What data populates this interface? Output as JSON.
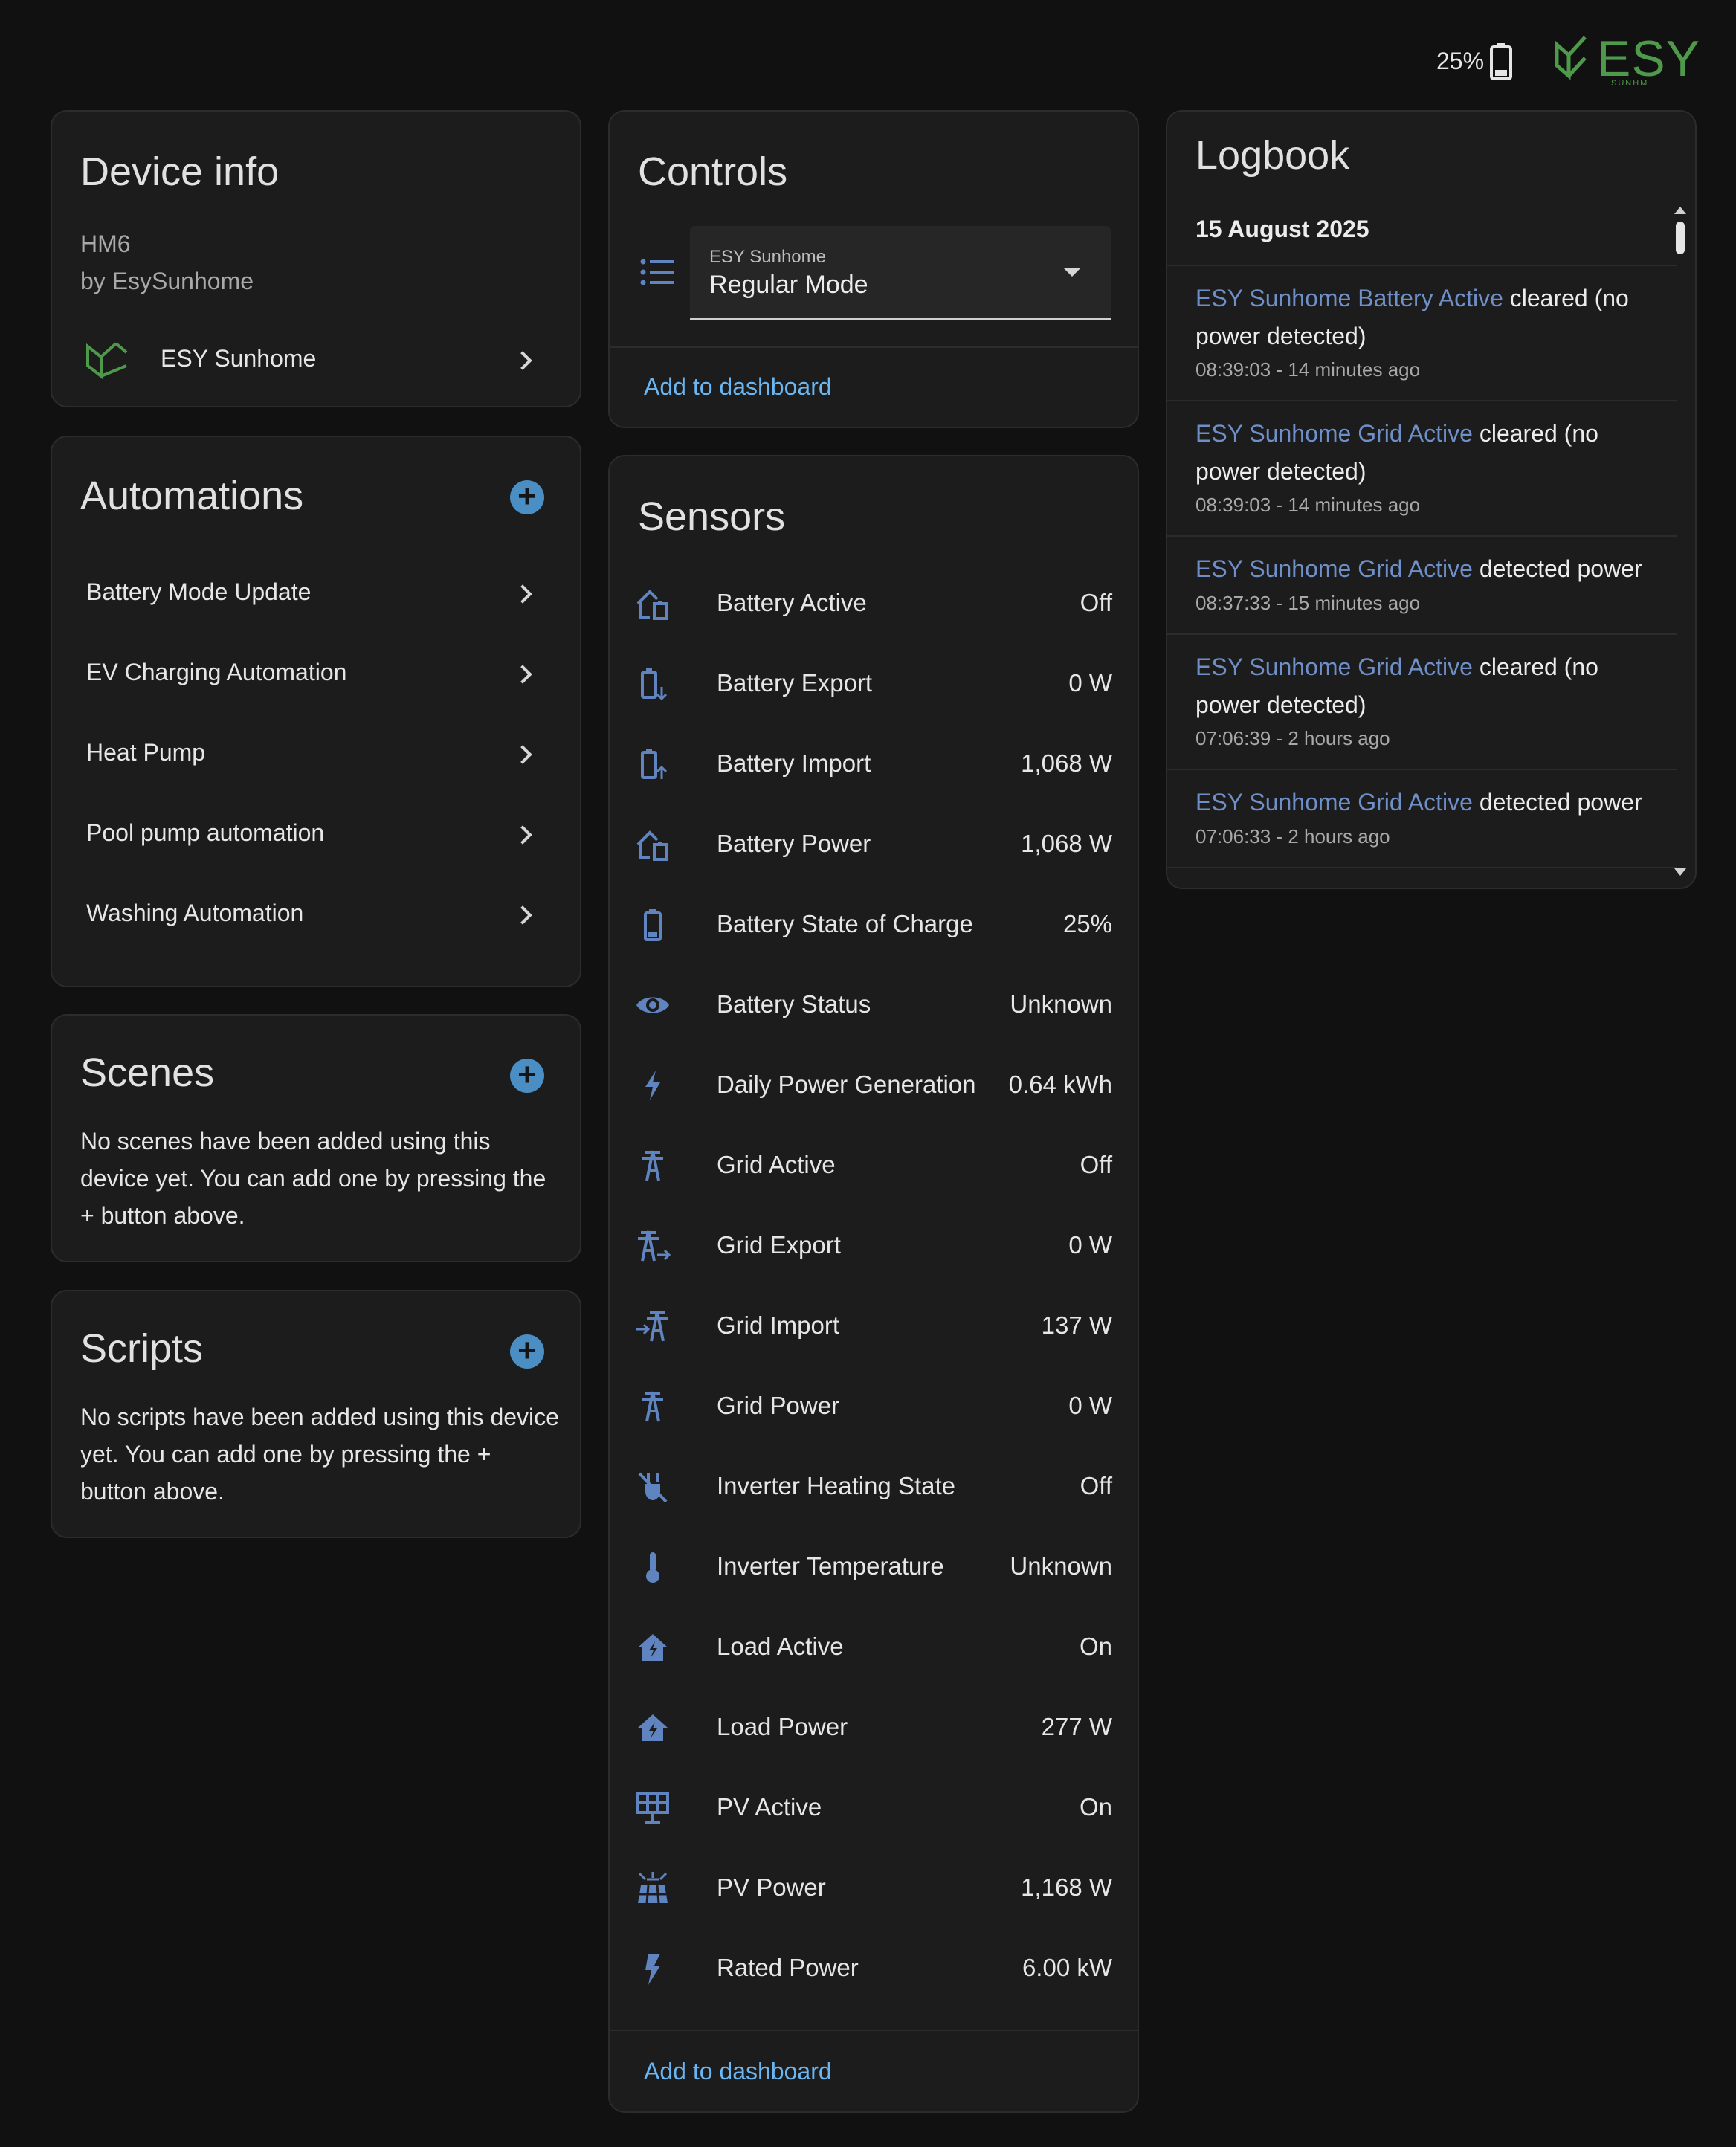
{
  "header": {
    "battery_percent": "25%",
    "brand_word": "ESY",
    "brand_sub": "SUNHM",
    "brand_color": "#4f9a4a"
  },
  "device_info": {
    "title": "Device info",
    "model": "HM6",
    "manufacturer": "by EsySunhome",
    "device_name": "ESY Sunhome"
  },
  "automations": {
    "title": "Automations",
    "items": [
      {
        "label": "Battery Mode Update"
      },
      {
        "label": "EV Charging Automation"
      },
      {
        "label": "Heat Pump"
      },
      {
        "label": "Pool pump automation"
      },
      {
        "label": "Washing Automation"
      }
    ]
  },
  "scenes": {
    "title": "Scenes",
    "empty_text": "No scenes have been added using this device yet. You can add one by pressing the + button above."
  },
  "scripts": {
    "title": "Scripts",
    "empty_text": "No scripts have been added using this device yet. You can add one by pressing the + button above."
  },
  "controls": {
    "title": "Controls",
    "select_label": "ESY Sunhome",
    "select_value": "Regular Mode",
    "add_to_dashboard": "Add to dashboard"
  },
  "sensors": {
    "title": "Sensors",
    "add_to_dashboard": "Add to dashboard",
    "icon_color": "#5f84bf",
    "items": [
      {
        "name": "Battery Active",
        "value": "Off",
        "icon": "home-battery-icon"
      },
      {
        "name": "Battery Export",
        "value": "0 W",
        "icon": "battery-arrow-down-icon"
      },
      {
        "name": "Battery Import",
        "value": "1,068 W",
        "icon": "battery-arrow-up-icon"
      },
      {
        "name": "Battery Power",
        "value": "1,068 W",
        "icon": "home-battery-icon"
      },
      {
        "name": "Battery State of Charge",
        "value": "25%",
        "icon": "battery-icon"
      },
      {
        "name": "Battery Status",
        "value": "Unknown",
        "icon": "eye-icon"
      },
      {
        "name": "Daily Power Generation",
        "value": "0.64 kWh",
        "icon": "flash-icon"
      },
      {
        "name": "Grid Active",
        "value": "Off",
        "icon": "transmission-tower-icon"
      },
      {
        "name": "Grid Export",
        "value": "0 W",
        "icon": "transmission-tower-export-icon"
      },
      {
        "name": "Grid Import",
        "value": "137 W",
        "icon": "transmission-tower-import-icon"
      },
      {
        "name": "Grid Power",
        "value": "0 W",
        "icon": "transmission-tower-icon"
      },
      {
        "name": "Inverter Heating State",
        "value": "Off",
        "icon": "heating-off-icon"
      },
      {
        "name": "Inverter Temperature",
        "value": "Unknown",
        "icon": "thermometer-icon"
      },
      {
        "name": "Load Active",
        "value": "On",
        "icon": "home-lightning-icon"
      },
      {
        "name": "Load Power",
        "value": "277 W",
        "icon": "home-lightning-icon"
      },
      {
        "name": "PV Active",
        "value": "On",
        "icon": "solar-panel-icon"
      },
      {
        "name": "PV Power",
        "value": "1,168 W",
        "icon": "solar-power-icon"
      },
      {
        "name": "Rated Power",
        "value": "6.00 kW",
        "icon": "flash-outline-icon"
      }
    ]
  },
  "logbook": {
    "title": "Logbook",
    "date": "15 August 2025",
    "entries": [
      {
        "entity": "ESY Sunhome Battery Active",
        "message": " cleared (no power detected)",
        "time": "08:39:03 - 14 minutes ago"
      },
      {
        "entity": "ESY Sunhome Grid Active",
        "message": " cleared (no power detected)",
        "time": "08:39:03 - 14 minutes ago"
      },
      {
        "entity": "ESY Sunhome Grid Active",
        "message": " detected power",
        "time": "08:37:33 - 15 minutes ago"
      },
      {
        "entity": "ESY Sunhome Grid Active",
        "message": " cleared (no power detected)",
        "time": "07:06:39 - 2 hours ago"
      },
      {
        "entity": "ESY Sunhome Grid Active",
        "message": " detected power",
        "time": "07:06:33 - 2 hours ago"
      }
    ]
  }
}
